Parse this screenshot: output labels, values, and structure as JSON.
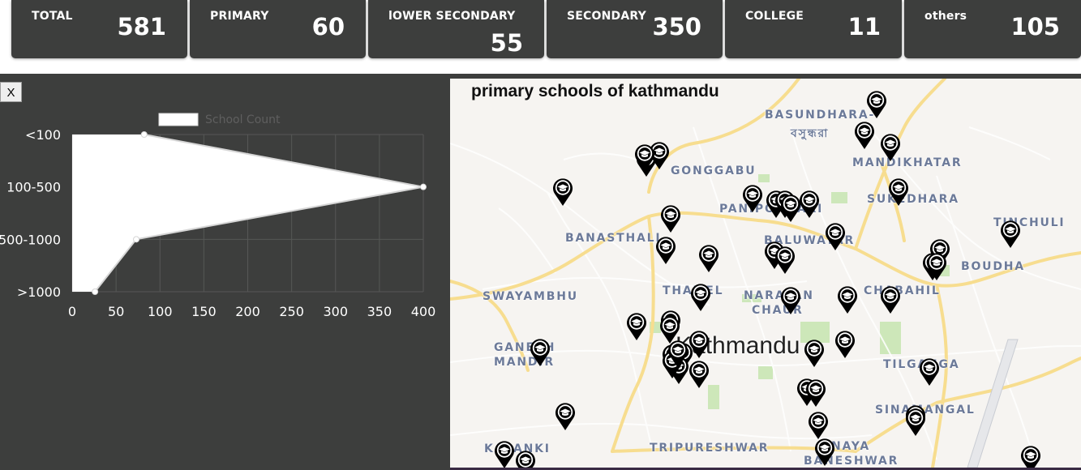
{
  "stats": [
    {
      "label": "TOTAL",
      "value": "581"
    },
    {
      "label": "PRIMARY",
      "value": "60"
    },
    {
      "label": "lOWER SECONDARY",
      "value": "55"
    },
    {
      "label": "SECONDARY",
      "value": "350"
    },
    {
      "label": "COLLEGE",
      "value": "11"
    },
    {
      "label": "others",
      "value": "105"
    }
  ],
  "close_label": "X",
  "chart_data": {
    "type": "area",
    "orientation": "horizontal",
    "categories": [
      "<100",
      "100-500",
      "500-1000",
      ">1000"
    ],
    "series": [
      {
        "name": "School Count",
        "values": [
          82,
          400,
          73,
          26
        ]
      }
    ],
    "xlim": [
      0,
      400
    ],
    "xticks": [
      0,
      50,
      100,
      150,
      200,
      250,
      300,
      350,
      400
    ],
    "legend_position": "top",
    "grid": true
  },
  "map": {
    "title": "primary schools of kathmandu",
    "city_label": "Kathmandu",
    "districts": [
      {
        "name": "BASUNDHARA-"
      },
      {
        "name": "বসুন্ধরা"
      },
      {
        "name": "MANDIKHATAR"
      },
      {
        "name": "GONGGABU"
      },
      {
        "name": "SUKEDHARA"
      },
      {
        "name": "PANIPOKHARI"
      },
      {
        "name": "TINCHULI"
      },
      {
        "name": "BANASTHALI"
      },
      {
        "name": "BALUWATAR"
      },
      {
        "name": "BOUDHA"
      },
      {
        "name": "SWAYAMBHU"
      },
      {
        "name": "THAMEL"
      },
      {
        "name": "NARAYAN"
      },
      {
        "name": "CHAUR"
      },
      {
        "name": "CHABAHIL"
      },
      {
        "name": "GANESH"
      },
      {
        "name": "MANDIR"
      },
      {
        "name": "TILGANGA"
      },
      {
        "name": "SINAMANGAL"
      },
      {
        "name": "KALANKI"
      },
      {
        "name": "TRIPURESHWAR"
      },
      {
        "name": "NAYA"
      },
      {
        "name": "BANESHWAR"
      }
    ],
    "marker_icon": "school-map-pin-icon",
    "marker_count": 51
  }
}
